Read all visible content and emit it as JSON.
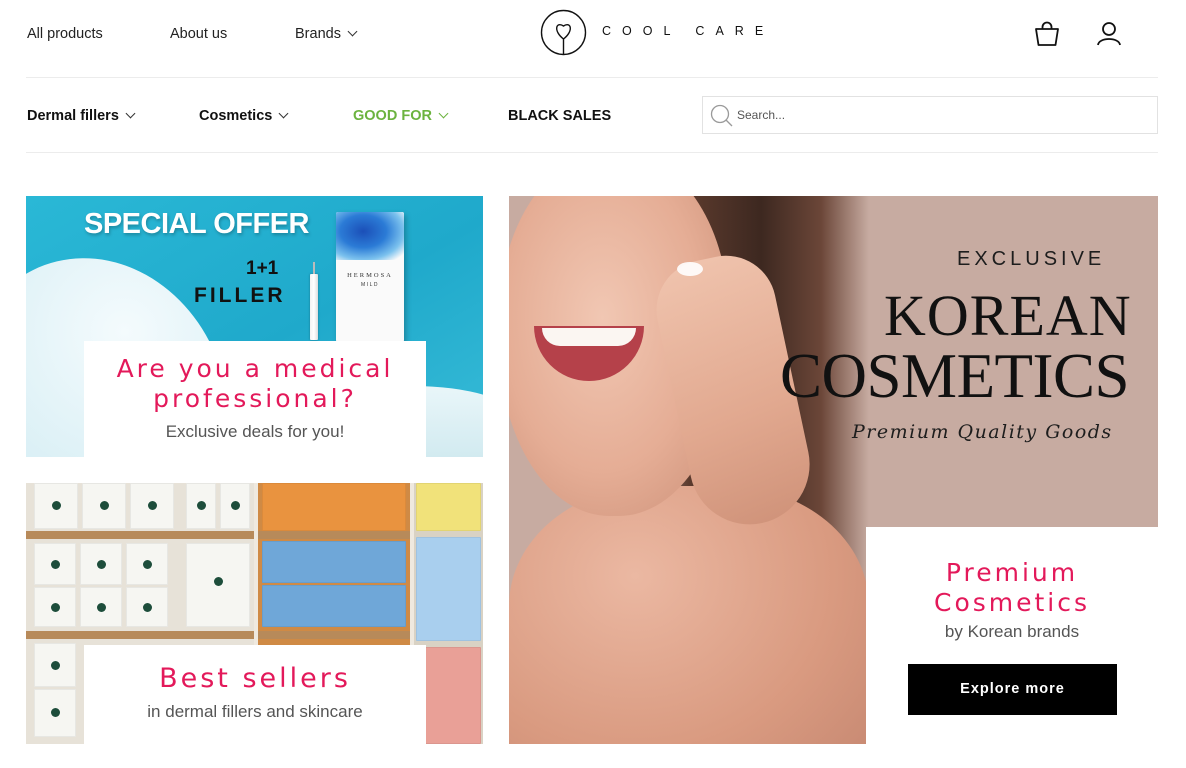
{
  "header": {
    "links": [
      "All products",
      "About us",
      "Brands"
    ],
    "logo_text": "COOL CARE"
  },
  "categories": [
    {
      "label": "Dermal fillers",
      "has_dropdown": true
    },
    {
      "label": "Cosmetics",
      "has_dropdown": true
    },
    {
      "label": "GOOD FOR",
      "has_dropdown": true,
      "color": "#6cb33f"
    },
    {
      "label": "BLACK SALES",
      "has_dropdown": false
    }
  ],
  "search": {
    "placeholder": "Search..."
  },
  "banners": {
    "offer": {
      "image_text": {
        "headline": "SPECIAL OFFER",
        "deal_line1": "1+1",
        "deal_line2": "FILLER",
        "product_brand": "HERMOSA",
        "product_variant": "MILD"
      },
      "title": "Are you a medical professional?",
      "subtitle": "Exclusive deals for you!"
    },
    "best_sellers": {
      "title": "Best sellers",
      "subtitle": "in dermal fillers and skincare"
    },
    "korean": {
      "image_text": {
        "eyebrow": "EXCLUSIVE",
        "line1": "KOREAN",
        "line2": "COSMETICS",
        "tagline": "Premium Quality Goods"
      },
      "title": "Premium Cosmetics",
      "subtitle": "by Korean brands",
      "button": "Explore more"
    }
  },
  "colors": {
    "accent": "#e3195a",
    "green": "#6cb33f",
    "button_bg": "#000000"
  },
  "icons": [
    "heart-logo-icon",
    "shopping-bag-icon",
    "user-icon",
    "search-icon",
    "chevron-down-icon"
  ]
}
